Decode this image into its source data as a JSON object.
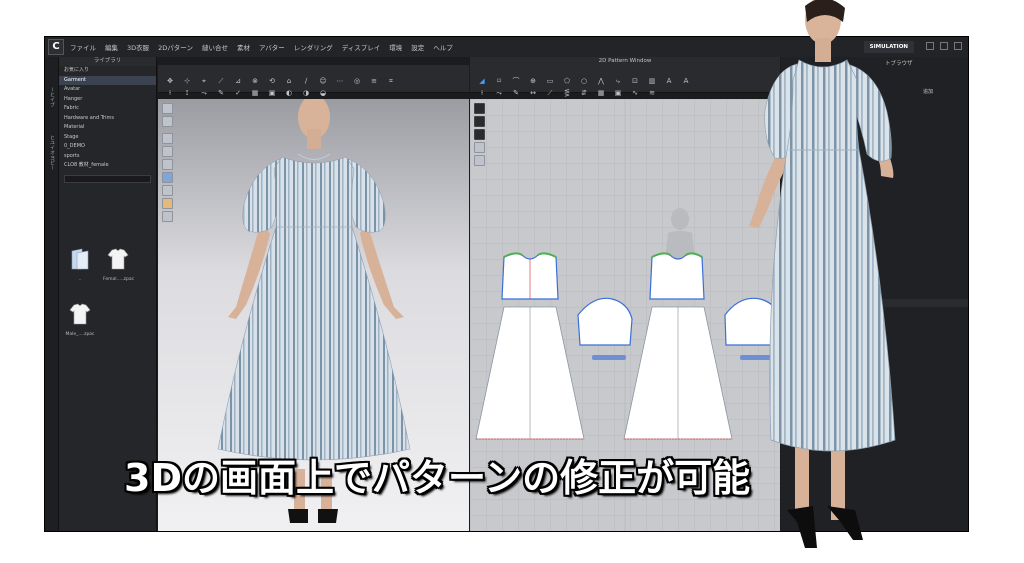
{
  "app": {
    "logo": "C",
    "menu": [
      "ファイル",
      "編集",
      "3D衣服",
      "2Dパターン",
      "縫い合せ",
      "素材",
      "アバター",
      "レンダリング",
      "ディスプレイ",
      "環境",
      "設定",
      "ヘルプ"
    ],
    "simulation_label": "SIMULATION"
  },
  "left_strip": {
    "tabs": [
      "ーヒイブ",
      "ヒユイオヨピー"
    ]
  },
  "library": {
    "title": "ライブラリ",
    "items": [
      "お気に入り",
      "Garment",
      "Avatar",
      "Hanger",
      "Fabric",
      "Hardware and Trims",
      "Material",
      "Stage",
      "0_DEMO",
      "sports",
      "CLO8 教材_female"
    ],
    "selected_index": 1,
    "thumbnails": [
      {
        "label": "..",
        "icon": "folder-icon"
      },
      {
        "label": "Femal.....zpac",
        "icon": "tshirt-icon"
      },
      {
        "label": "Male_....zpac",
        "icon": "tshirt-icon"
      }
    ]
  },
  "pattern_window": {
    "title": "2D Pattern Window"
  },
  "right_panel": {
    "object_browser": "トブラウザ",
    "property_tab": "追加"
  },
  "caption": "3Dの画面上でパターンの修正が可能",
  "colors": {
    "app_bg": "#1b1c1e",
    "dress_fabric": "#9eb4c4",
    "stripe_dark": "#6f879a",
    "stripe_light": "#d9e2ea",
    "seam_green": "#4caf50",
    "outline_blue": "#3a6fd8",
    "caption_text": "#ffffff"
  }
}
